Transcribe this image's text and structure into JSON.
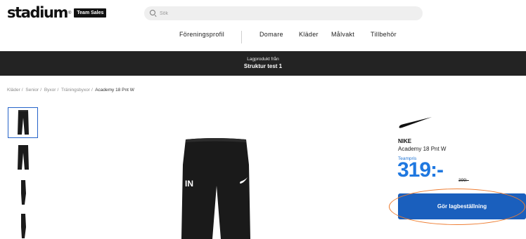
{
  "header": {
    "logo_word": "stadium",
    "logo_badge": "Team Sales",
    "search_placeholder": "Sök"
  },
  "nav": {
    "items": [
      "Föreningsprofil",
      "Domare",
      "Kläder",
      "Målvakt",
      "Tillbehör"
    ]
  },
  "banner": {
    "subtitle": "Lagprodukt från",
    "title": "Struktur test 1"
  },
  "breadcrumb": [
    "Kläder",
    "Senior",
    "Byxor",
    "Träningsbyxor",
    "Academy 18 Pnt W"
  ],
  "product": {
    "brand": "NIKE",
    "name": "Academy 18 Pnt W",
    "price_label": "Teampris",
    "price": "319:-",
    "old_price": "399:-",
    "cta_label": "Gör lagbeställning",
    "image_print": "IN"
  },
  "colors": {
    "accent_blue": "#1a5fbd",
    "price_blue": "#1f78e0",
    "banner_bg": "#232323",
    "highlight": "#ee7d32"
  },
  "icons": [
    "search-icon",
    "nike-swoosh-icon"
  ]
}
